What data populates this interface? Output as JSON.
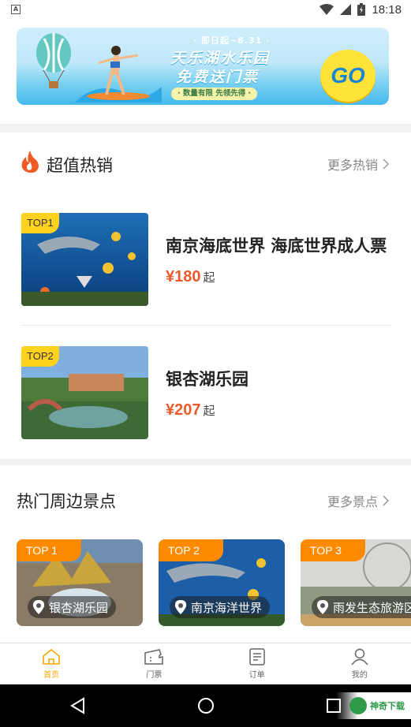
{
  "status_bar": {
    "time": "18:18",
    "notify_glyph": "A"
  },
  "banner": {
    "date": "· 即日起~8.31 ·",
    "title_line1": "天乐湖水乐园",
    "title_line2": "免费送门票",
    "subtitle": "· 数量有限 先领先得 ·",
    "go_label": "GO"
  },
  "hot_section": {
    "title": "超值热销",
    "more_label": "更多热销",
    "items": [
      {
        "tag": "TOP1",
        "name": "南京海底世界 海底世界成人票",
        "price": "¥180",
        "suffix": "起"
      },
      {
        "tag": "TOP2",
        "name": "银杏湖乐园",
        "price": "¥207",
        "suffix": "起"
      }
    ]
  },
  "nearby_section": {
    "title": "热门周边景点",
    "more_label": "更多景点",
    "spots": [
      {
        "tag": "TOP 1",
        "name": "银杏湖乐园"
      },
      {
        "tag": "TOP 2",
        "name": "南京海洋世界"
      },
      {
        "tag": "TOP 3",
        "name": "雨发生态旅游区"
      }
    ]
  },
  "tabbar": {
    "tabs": [
      {
        "label": "首页",
        "icon": "home-icon",
        "active": true
      },
      {
        "label": "门票",
        "icon": "ticket-icon",
        "active": false
      },
      {
        "label": "订单",
        "icon": "order-icon",
        "active": false
      },
      {
        "label": "我的",
        "icon": "user-icon",
        "active": false
      }
    ]
  },
  "watermark": {
    "text": "神奇下载"
  },
  "colors": {
    "accent": "#f5a800",
    "price": "#e85a2c",
    "tag_yellow": "#ffd21e",
    "tag_orange": "#ff8a00"
  }
}
